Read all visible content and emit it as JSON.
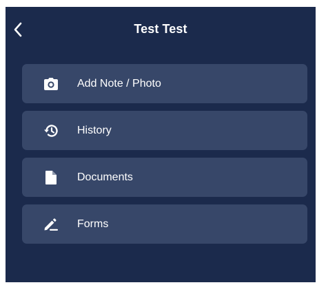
{
  "header": {
    "title": "Test Test",
    "back_icon": "chevron-left-icon"
  },
  "menu": {
    "items": [
      {
        "label": "Add Note / Photo",
        "icon": "camera-icon"
      },
      {
        "label": "History",
        "icon": "history-icon"
      },
      {
        "label": "Documents",
        "icon": "document-icon"
      },
      {
        "label": "Forms",
        "icon": "pen-icon"
      }
    ]
  },
  "colors": {
    "background": "#1b2a4c",
    "item_background": "#374769",
    "text": "#ffffff"
  }
}
